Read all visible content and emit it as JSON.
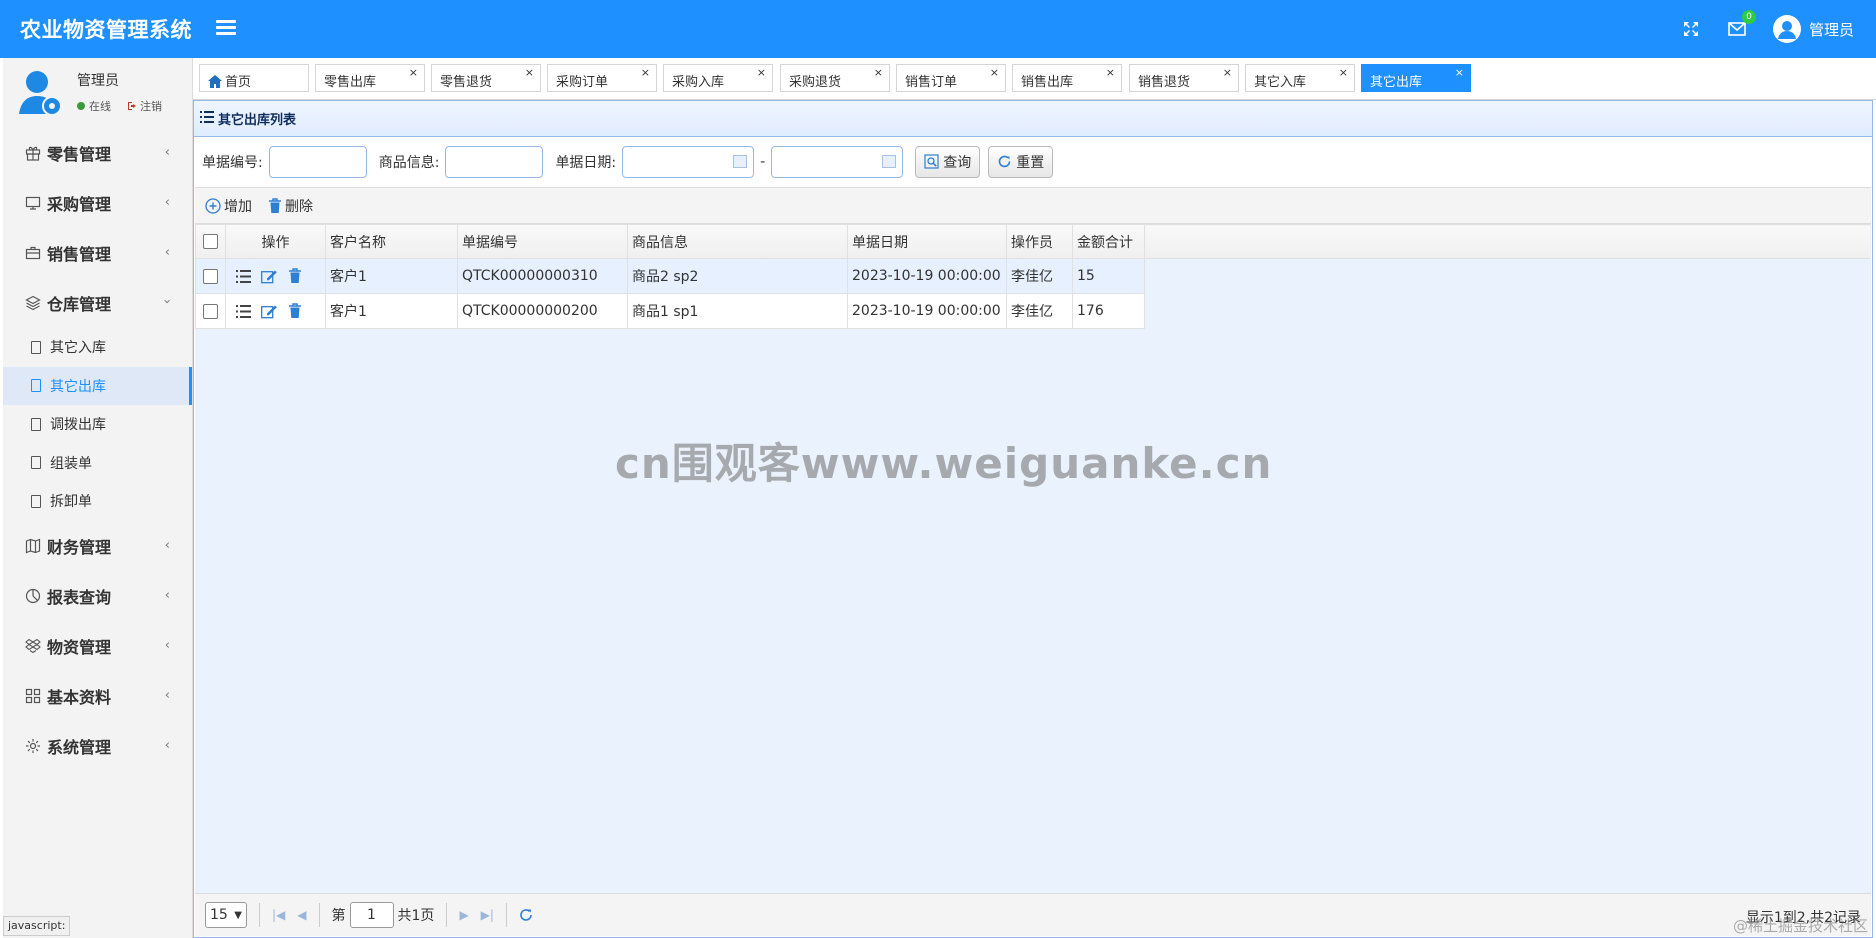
{
  "app": {
    "title": "农业物资管理系统"
  },
  "header": {
    "mail_count": "0",
    "user_name": "管理员"
  },
  "user_panel": {
    "name": "管理员",
    "status": "在线",
    "logout": "注销"
  },
  "sidebar": {
    "groups": [
      {
        "label": "零售管理",
        "icon": "gift-icon"
      },
      {
        "label": "采购管理",
        "icon": "monitor-icon"
      },
      {
        "label": "销售管理",
        "icon": "briefcase-icon"
      },
      {
        "label": "仓库管理",
        "icon": "layers-icon"
      },
      {
        "label": "财务管理",
        "icon": "map-icon"
      },
      {
        "label": "报表查询",
        "icon": "pie-chart-icon"
      },
      {
        "label": "物资管理",
        "icon": "dropbox-icon"
      },
      {
        "label": "基本资料",
        "icon": "grid-icon"
      },
      {
        "label": "系统管理",
        "icon": "gear-icon"
      }
    ],
    "warehouse_items": [
      "其它入库",
      "其它出库",
      "调拨出库",
      "组装单",
      "拆卸单"
    ]
  },
  "tabs": [
    "首页",
    "零售出库",
    "零售退货",
    "采购订单",
    "采购入库",
    "采购退货",
    "销售订单",
    "销售出库",
    "销售退货",
    "其它入库",
    "其它出库"
  ],
  "panel": {
    "title": "其它出库列表"
  },
  "search": {
    "bill_no_label": "单据编号:",
    "goods_label": "商品信息:",
    "date_label": "单据日期:",
    "dash": "-",
    "query_button": "查询",
    "reset_button": "重置"
  },
  "toolbar": {
    "add_label": "增加",
    "delete_label": "删除"
  },
  "table": {
    "headers": [
      "操作",
      "客户名称",
      "单据编号",
      "商品信息",
      "单据日期",
      "操作员",
      "金额合计"
    ],
    "rows": [
      [
        "客户1",
        "QTCK00000000310",
        "商品2 sp2",
        "2023-10-19 00:00:00",
        "李佳亿",
        "15"
      ],
      [
        "客户1",
        "QTCK00000000200",
        "商品1 sp1",
        "2023-10-19 00:00:00",
        "李佳亿",
        "176"
      ]
    ]
  },
  "pager": {
    "page_size": "15",
    "page_prefix": "第",
    "page_value": "1",
    "page_suffix": "共1页",
    "info": "显示1到2,共2记录"
  },
  "watermark": "cn围观客www.weiguanke.cn",
  "status_bar": "javascript:",
  "corner_watermark": "@稀土掘金技术社区",
  "colors": {
    "brand": "#1e90ff",
    "online": "#3c9a3c",
    "badge": "#2ecc40"
  }
}
